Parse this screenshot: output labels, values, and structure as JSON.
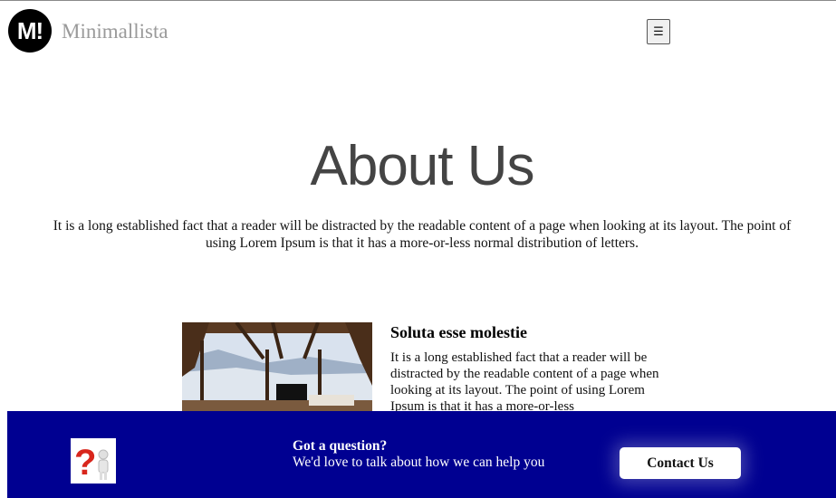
{
  "header": {
    "logo_text": "M!",
    "brand": "Minimallista",
    "menu_icon": "☰"
  },
  "hero": {
    "title": "About Us",
    "intro": "It is a long established fact that a reader will be distracted by the readable content of a page when looking at its layout. The point of using Lorem Ipsum is that it has a more-or-less normal distribution of letters."
  },
  "feature": {
    "image_name": "room-photo",
    "title": "Soluta esse molestie",
    "text": "It is a long established fact that a reader will be distracted by the readable content of a page when looking at its layout. The point of using Lorem Ipsum is that it has a more-or-less"
  },
  "cta": {
    "icon": "question-person-icon",
    "heading": "Got a question?",
    "subtext": "We'd love to talk about how we can help you",
    "button_label": "Contact Us",
    "background_color": "#000091"
  }
}
